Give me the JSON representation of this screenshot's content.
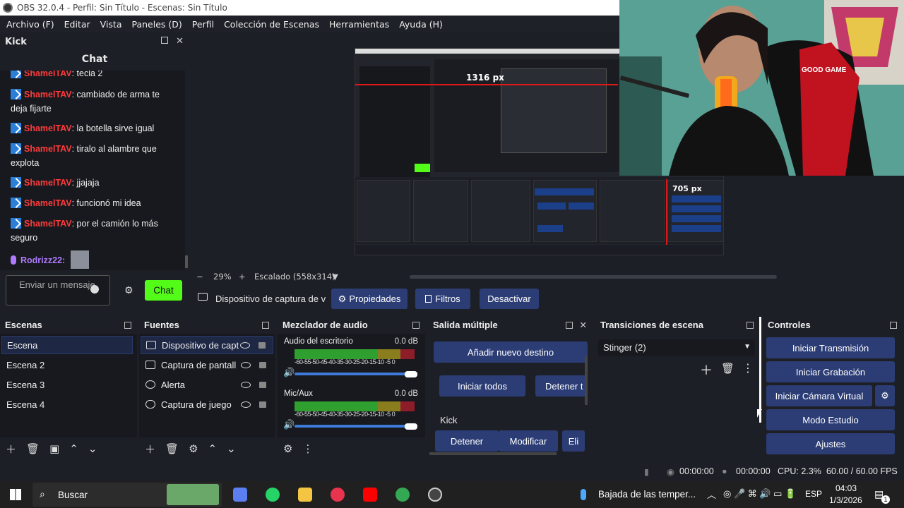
{
  "window": {
    "title": "OBS 32.0.4 - Perfil: Sin Título - Escenas: Sin Título"
  },
  "menu": [
    "Archivo (F)",
    "Editar",
    "Vista",
    "Paneles (D)",
    "Perfil",
    "Colección de Escenas",
    "Herramientas",
    "Ayuda (H)"
  ],
  "chat_dock": {
    "dock_title": "Kick",
    "title": "Chat",
    "messages": [
      {
        "user": "ShamelTAV",
        "text": ": tecla 2"
      },
      {
        "user": "ShamelTAV",
        "text": ": cambiado de arma te deja fijarte"
      },
      {
        "user": "ShamelTAV",
        "text": ": la botella sirve igual"
      },
      {
        "user": "ShamelTAV",
        "text": ": tiralo al alambre que explota"
      },
      {
        "user": "ShamelTAV",
        "text": ": jjajaja"
      },
      {
        "user": "ShamelTAV",
        "text": ": funcionó mi idea"
      },
      {
        "user": "ShamelTAV",
        "text": ": por el camión lo más seguro"
      }
    ],
    "last_user": "Rodrizz22:",
    "input_placeholder": "Enviar un mensaje",
    "send_label": "Chat"
  },
  "preview": {
    "nested_px_top": "1316 px",
    "nested_px_right": "705 px",
    "zoom": "29%",
    "scale_label": "Escalado (558x314)"
  },
  "source_toolbar": {
    "source_name": "Dispositivo de captura de v",
    "properties": "Propiedades",
    "filters": "Filtros",
    "deactivate": "Desactivar"
  },
  "scenes": {
    "title": "Escenas",
    "items": [
      "Escena",
      "Escena 2",
      "Escena 3",
      "Escena 4"
    ]
  },
  "sources": {
    "title": "Fuentes",
    "items": [
      "Dispositivo de capt",
      "Captura de pantall",
      "Alerta",
      "Captura de juego"
    ]
  },
  "mixer": {
    "title": "Mezclador de audio",
    "channels": [
      {
        "name": "Audio del escritorio",
        "db": "0.0 dB"
      },
      {
        "name": "Mic/Aux",
        "db": "0.0 dB"
      }
    ],
    "scale": "-60-55-50-45-40-35-30-25-20-15-10 -5 0"
  },
  "multi_output": {
    "title": "Salida múltiple",
    "add": "Añadir nuevo destino",
    "start_all": "Iniciar todos",
    "stop_all": "Detener t",
    "target": "Kick",
    "stop": "Detener",
    "modify": "Modificar",
    "delete": "Eli"
  },
  "transitions": {
    "title": "Transiciones de escena",
    "selected": "Stinger (2)"
  },
  "controls": {
    "title": "Controles",
    "start_stream": "Iniciar Transmisión",
    "start_record": "Iniciar Grabación",
    "virtual_cam": "Iniciar Cámara Virtual",
    "studio": "Modo Estudio",
    "settings": "Ajustes"
  },
  "status": {
    "stream_time": "00:00:00",
    "record_time": "00:00:00",
    "cpu": "CPU: 2.3%",
    "fps": "60.00 / 60.00 FPS"
  },
  "taskbar": {
    "search": "Buscar",
    "weather": "Bajada de las temper...",
    "lang": "ESP",
    "time": "04:03",
    "date": "1/3/2026",
    "notifications": "1"
  },
  "colors": {
    "kick_green": "#53fc18",
    "button_blue": "#2c3d75",
    "user_red": "#ff3b3b"
  }
}
